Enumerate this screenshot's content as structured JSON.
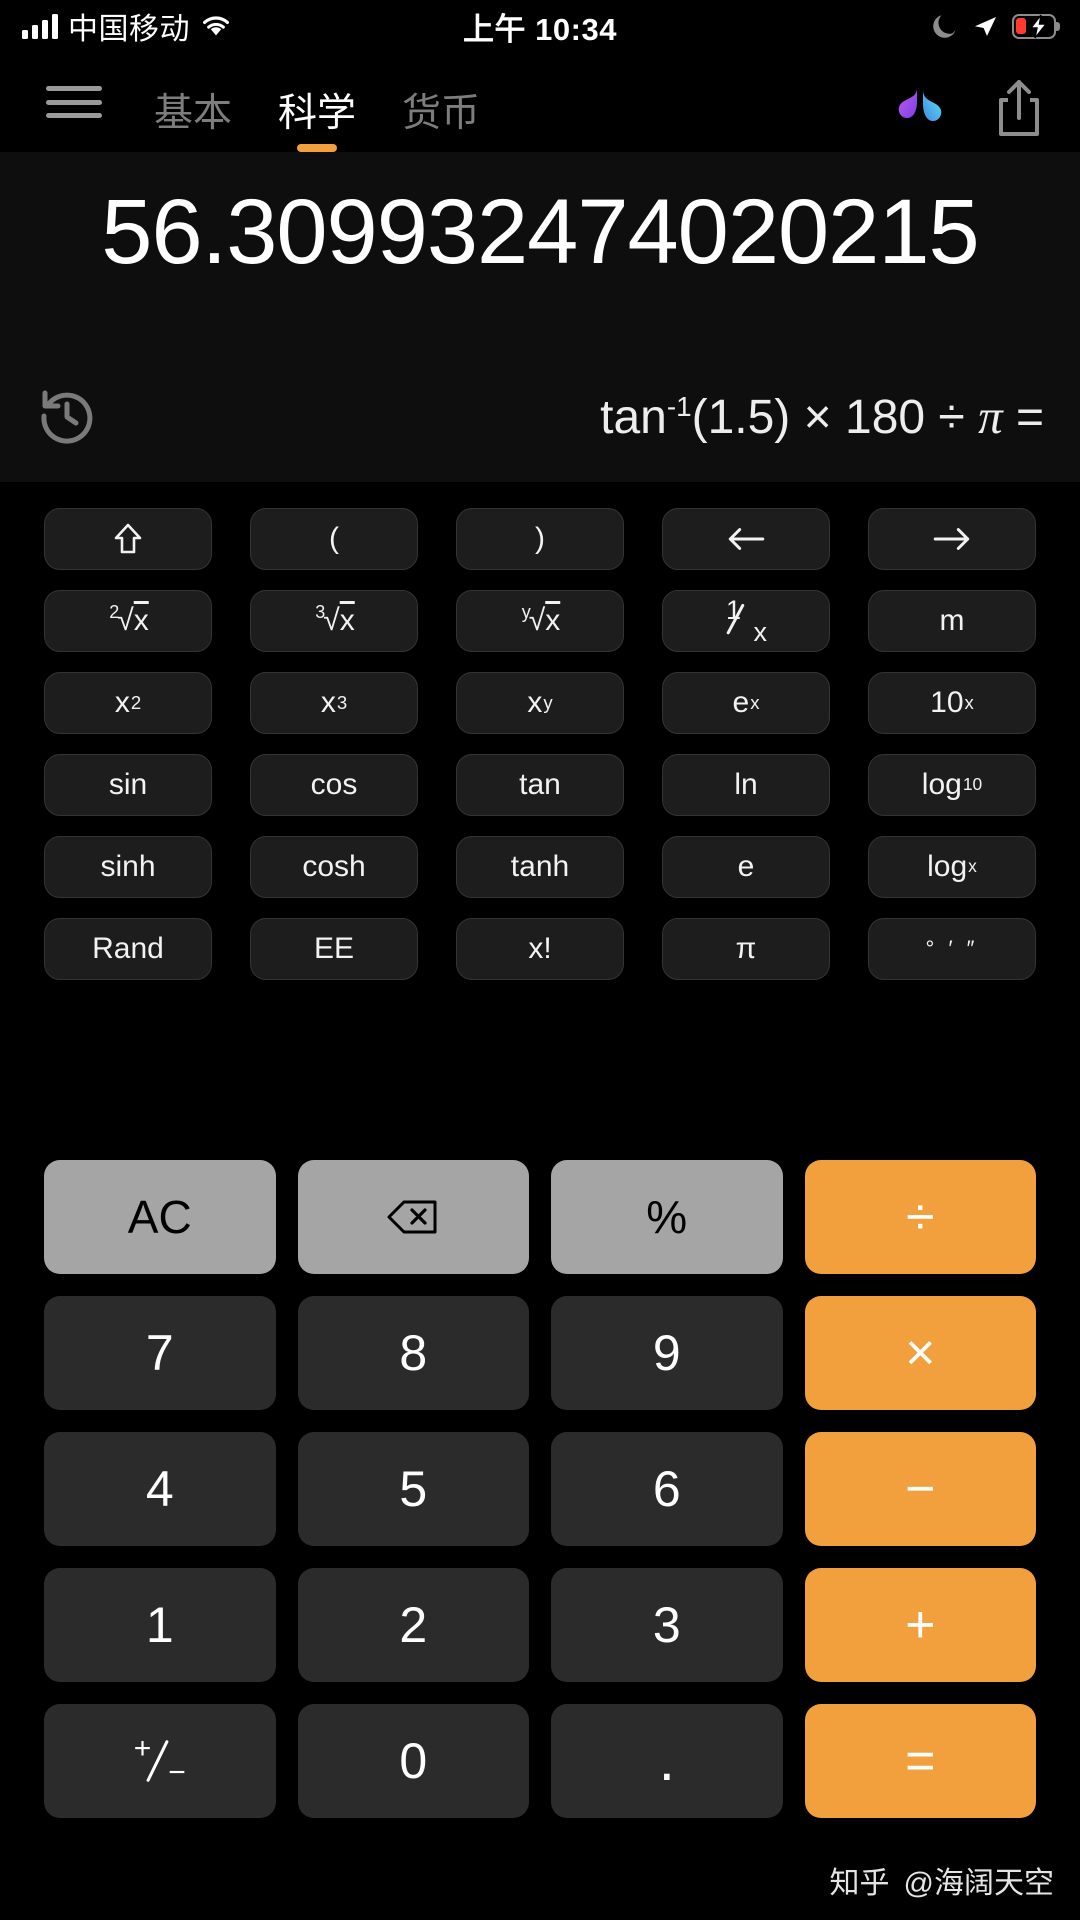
{
  "status_bar": {
    "carrier": "中国移动",
    "time": "上午 10:34",
    "signal_icon": "signal-bars-icon",
    "wifi_icon": "wifi-icon",
    "moon_icon": "moon-icon",
    "location_icon": "location-arrow-icon",
    "battery_icon": "battery-charging-low-icon",
    "battery_color": "#ff3b30"
  },
  "navbar": {
    "menu_icon": "hamburger-menu-icon",
    "tabs": [
      {
        "label": "基本",
        "active": false
      },
      {
        "label": "科学",
        "active": true
      },
      {
        "label": "货币",
        "active": false
      }
    ],
    "logo_icon": "butterfly-logo-icon",
    "share_icon": "share-icon",
    "accent_color": "#F2A03D"
  },
  "display": {
    "result": "56.309932474020215",
    "history_icon": "history-clock-icon",
    "expression": {
      "fn": "tan",
      "exponent": "-1",
      "rest": "(1.5) × 180 ÷ ",
      "pi": "π",
      "equals": " ="
    },
    "expression_plain": "tan⁻¹(1.5) × 180 ÷ π ="
  },
  "scientific_keys": {
    "rows": [
      [
        {
          "name": "shift-key",
          "label": "⇧",
          "type": "icon"
        },
        {
          "name": "open-paren-key",
          "label": "(",
          "type": "text"
        },
        {
          "name": "close-paren-key",
          "label": ")",
          "type": "text"
        },
        {
          "name": "cursor-left-key",
          "label": "←",
          "type": "icon"
        },
        {
          "name": "cursor-right-key",
          "label": "→",
          "type": "icon"
        }
      ],
      [
        {
          "name": "square-root-key",
          "label": "²√x",
          "type": "radical",
          "index": "2"
        },
        {
          "name": "cube-root-key",
          "label": "³√x",
          "type": "radical",
          "index": "3"
        },
        {
          "name": "nth-root-key",
          "label": "ʸ√x",
          "type": "radical",
          "index": "y"
        },
        {
          "name": "reciprocal-key",
          "label": "1/x",
          "type": "frac"
        },
        {
          "name": "memory-key",
          "label": "m",
          "type": "text"
        }
      ],
      [
        {
          "name": "x-squared-key",
          "label": "x",
          "sup": "2",
          "type": "sup"
        },
        {
          "name": "x-cubed-key",
          "label": "x",
          "sup": "3",
          "type": "sup"
        },
        {
          "name": "x-power-y-key",
          "label": "x",
          "sup": "y",
          "type": "sup"
        },
        {
          "name": "e-power-x-key",
          "label": "e",
          "sup": "x",
          "type": "sup"
        },
        {
          "name": "ten-power-x-key",
          "label": "10",
          "sup": "x",
          "type": "sup"
        }
      ],
      [
        {
          "name": "sin-key",
          "label": "sin",
          "type": "text"
        },
        {
          "name": "cos-key",
          "label": "cos",
          "type": "text"
        },
        {
          "name": "tan-key",
          "label": "tan",
          "type": "text"
        },
        {
          "name": "ln-key",
          "label": "ln",
          "type": "text"
        },
        {
          "name": "log10-key",
          "label": "log",
          "sub": "10",
          "type": "sub"
        }
      ],
      [
        {
          "name": "sinh-key",
          "label": "sinh",
          "type": "text"
        },
        {
          "name": "cosh-key",
          "label": "cosh",
          "type": "text"
        },
        {
          "name": "tanh-key",
          "label": "tanh",
          "type": "text"
        },
        {
          "name": "euler-e-key",
          "label": "e",
          "type": "text"
        },
        {
          "name": "logx-key",
          "label": "log",
          "sub": "x",
          "type": "sub"
        }
      ],
      [
        {
          "name": "rand-key",
          "label": "Rand",
          "type": "text"
        },
        {
          "name": "ee-key",
          "label": "EE",
          "type": "text"
        },
        {
          "name": "factorial-key",
          "label": "x!",
          "type": "text"
        },
        {
          "name": "pi-key",
          "label": "π",
          "type": "text"
        },
        {
          "name": "degrees-minutes-seconds-key",
          "label": "° ′ ″",
          "type": "dms"
        }
      ]
    ]
  },
  "keypad": {
    "rows": [
      [
        {
          "name": "all-clear-key",
          "label": "AC",
          "style": "func"
        },
        {
          "name": "backspace-key",
          "label": "⌫",
          "style": "func",
          "icon": "backspace-icon"
        },
        {
          "name": "percent-key",
          "label": "%",
          "style": "func"
        },
        {
          "name": "divide-key",
          "label": "÷",
          "style": "op"
        }
      ],
      [
        {
          "name": "digit-7-key",
          "label": "7",
          "style": "num"
        },
        {
          "name": "digit-8-key",
          "label": "8",
          "style": "num"
        },
        {
          "name": "digit-9-key",
          "label": "9",
          "style": "num"
        },
        {
          "name": "multiply-key",
          "label": "×",
          "style": "op"
        }
      ],
      [
        {
          "name": "digit-4-key",
          "label": "4",
          "style": "num"
        },
        {
          "name": "digit-5-key",
          "label": "5",
          "style": "num"
        },
        {
          "name": "digit-6-key",
          "label": "6",
          "style": "num"
        },
        {
          "name": "subtract-key",
          "label": "−",
          "style": "op"
        }
      ],
      [
        {
          "name": "digit-1-key",
          "label": "1",
          "style": "num"
        },
        {
          "name": "digit-2-key",
          "label": "2",
          "style": "num"
        },
        {
          "name": "digit-3-key",
          "label": "3",
          "style": "num"
        },
        {
          "name": "add-key",
          "label": "+",
          "style": "op"
        }
      ],
      [
        {
          "name": "sign-toggle-key",
          "label": "+/−",
          "style": "num",
          "special": "plusminus"
        },
        {
          "name": "digit-0-key",
          "label": "0",
          "style": "num"
        },
        {
          "name": "decimal-point-key",
          "label": ".",
          "style": "num",
          "special": "dot"
        },
        {
          "name": "equals-key",
          "label": "=",
          "style": "op"
        }
      ]
    ],
    "colors": {
      "function": "#A5A5A5",
      "operator": "#F2A03D",
      "number": "#2b2b2b"
    }
  },
  "watermark": {
    "site": "知乎",
    "user": "@海阔天空"
  }
}
